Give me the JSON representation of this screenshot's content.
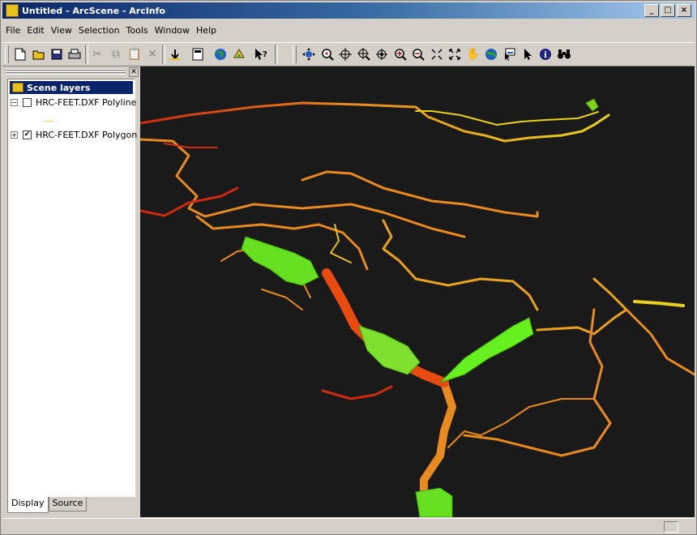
{
  "window": {
    "title": "Untitled - ArcScene - ArcInfo",
    "buttons": {
      "minimize": "_",
      "maximize": "□",
      "close": "×"
    }
  },
  "menu": [
    "File",
    "Edit",
    "View",
    "Selection",
    "Tools",
    "Window",
    "Help"
  ],
  "toolbar_standard": [
    "new-icon",
    "open-icon",
    "save-icon",
    "print-icon",
    "cut-icon",
    "copy-icon",
    "paste-icon",
    "delete-icon",
    "add-data-icon",
    "toc-icon",
    "globe-icon",
    "3d-analyst-icon",
    "whats-this-icon"
  ],
  "toolbar_nav": [
    "navigate-icon",
    "zoom-in-out-icon",
    "center-on-target-icon",
    "zoom-to-target-icon",
    "set-observer-icon",
    "zoom-in-icon",
    "zoom-out-icon",
    "narrow-fov-icon",
    "full-extent-icon",
    "pan-icon",
    "fly-icon",
    "select-features-icon",
    "select-elements-icon",
    "identify-icon",
    "find-icon"
  ],
  "toc": {
    "header": "Scene layers",
    "layers": [
      {
        "name": "HRC-FEET.DXF Polyline",
        "expander": "−",
        "checked": ""
      },
      {
        "name": "HRC-FEET.DXF Polygon",
        "expander": "+",
        "checked": "✔"
      }
    ],
    "tabs": [
      "Display",
      "Source"
    ]
  },
  "colors": {
    "scene_bg": "#1a1a1a",
    "cave_low": "#cc2a10",
    "cave_mid": "#e88a20",
    "cave_high": "#e8d020",
    "chamber": "#66e020"
  }
}
